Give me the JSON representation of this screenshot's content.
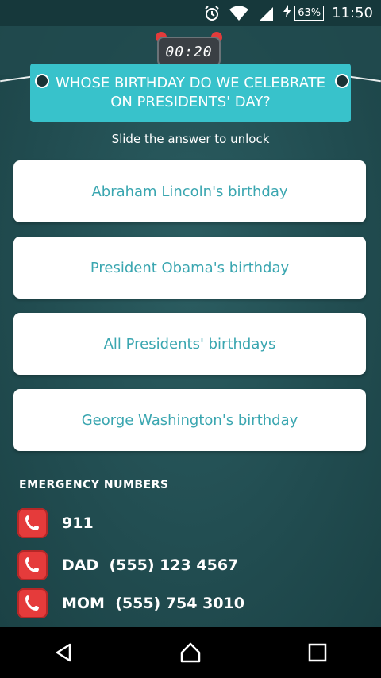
{
  "status": {
    "battery_percent": "63%",
    "time": "11:50"
  },
  "timer": "00:20",
  "question": "WHOSE BIRTHDAY DO WE CELEBRATE ON PRESIDENTS' DAY?",
  "subtitle": "Slide the answer to unlock",
  "answers": [
    "Abraham Lincoln's birthday",
    "President Obama's birthday",
    "All Presidents' birthdays",
    "George Washington's birthday"
  ],
  "emergency": {
    "title": "EMERGENCY NUMBERS",
    "contacts": [
      "911",
      "DAD  (555) 123 4567",
      "MOM  (555) 754 3010"
    ]
  },
  "icons": [
    "alarm-icon",
    "wifi-icon",
    "signal-icon",
    "charging-icon",
    "phone-icon",
    "back-icon",
    "home-icon",
    "recents-icon"
  ],
  "colors": {
    "accent": "#38c2cb",
    "answer_text": "#3aa6b0",
    "phone_red": "#e53b3b",
    "background": "#1f4d51"
  }
}
